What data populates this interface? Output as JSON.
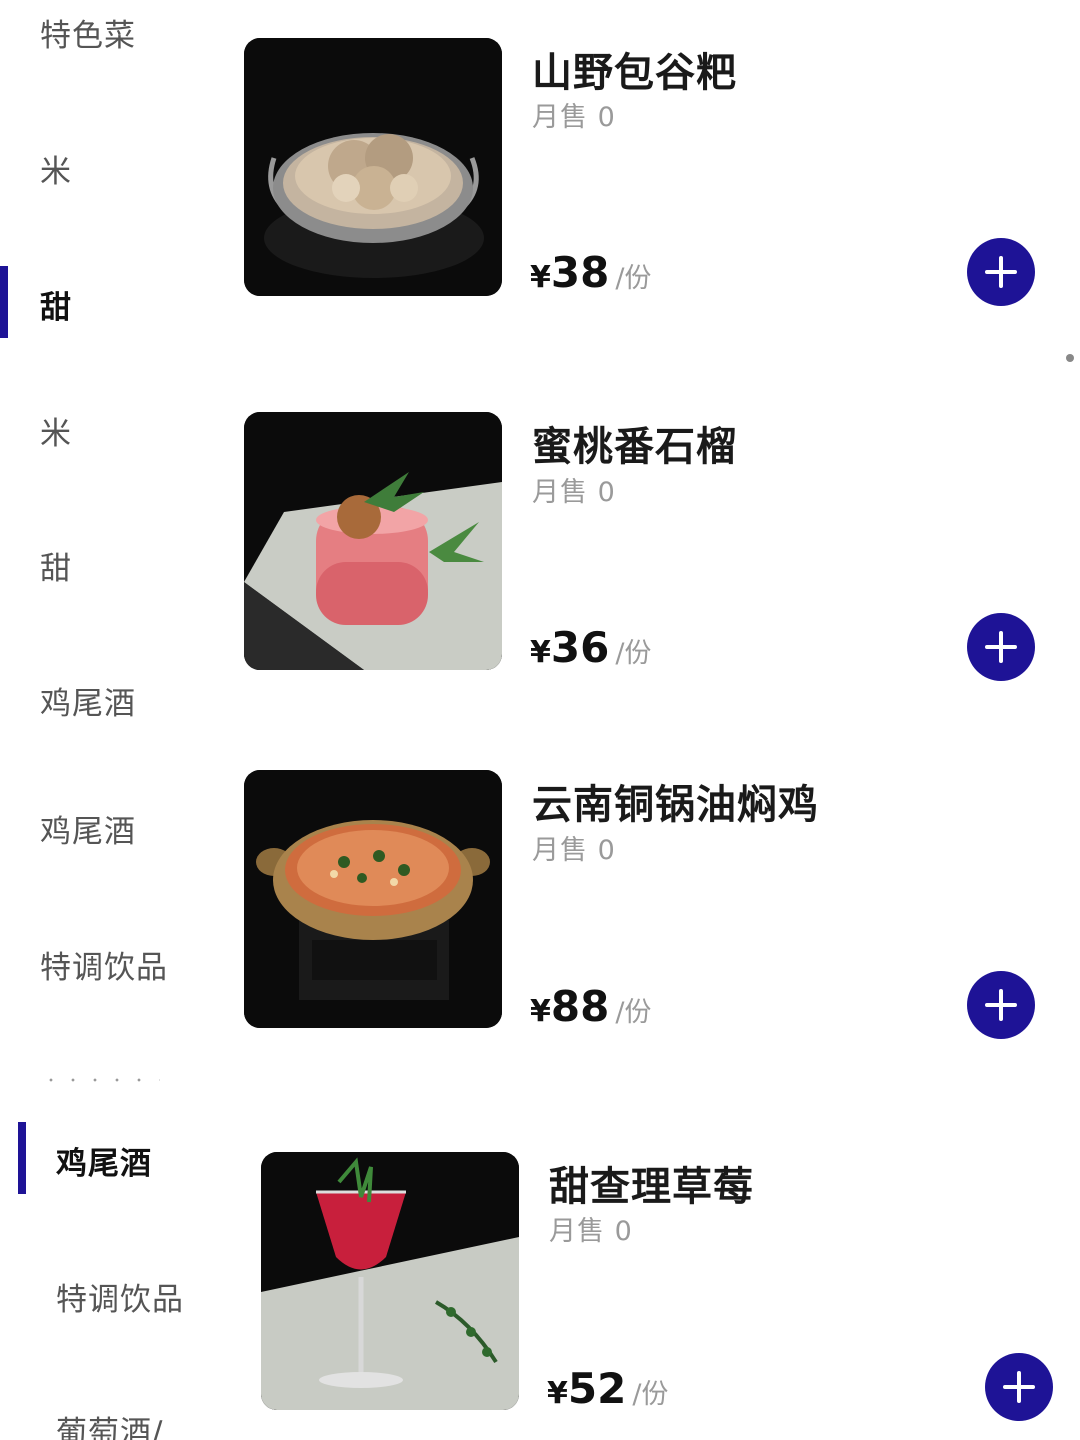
{
  "sidebar_top": {
    "items": [
      {
        "label": "特色菜"
      },
      {
        "label": "米"
      },
      {
        "label": "甜"
      },
      {
        "label": "米"
      },
      {
        "label": "甜"
      },
      {
        "label": "鸡尾酒"
      },
      {
        "label": "鸡尾酒"
      },
      {
        "label": "特调饮品"
      }
    ],
    "active_index": 2
  },
  "sidebar_bottom": {
    "items": [
      {
        "label": "鸡尾酒"
      },
      {
        "label": "特调饮品"
      },
      {
        "label": "葡萄酒/"
      }
    ],
    "active_index": 0
  },
  "products": [
    {
      "name": "山野包谷粑",
      "sales": "月售 0",
      "currency": "¥",
      "price": "38",
      "unit": "/份",
      "image_icon": "corn-cake-bowl-icon"
    },
    {
      "name": "蜜桃番石榴",
      "sales": "月售 0",
      "currency": "¥",
      "price": "36",
      "unit": "/份",
      "image_icon": "peach-cocktail-icon"
    },
    {
      "name": "云南铜锅油焖鸡",
      "sales": "月售 0",
      "currency": "¥",
      "price": "88",
      "unit": "/份",
      "image_icon": "copper-pot-chicken-icon"
    },
    {
      "name": "甜查理草莓",
      "sales": "月售 0",
      "currency": "¥",
      "price": "52",
      "unit": "/份",
      "image_icon": "strawberry-cocktail-icon"
    }
  ],
  "colors": {
    "accent": "#1e1396",
    "muted_text": "#9a9a9a",
    "sidebar_text": "#555555"
  }
}
